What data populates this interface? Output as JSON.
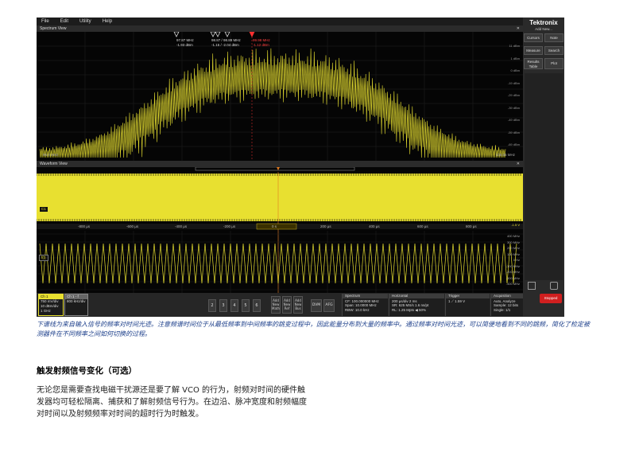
{
  "scope": {
    "menu": [
      "File",
      "Edit",
      "Utility",
      "Help"
    ],
    "brand": "Tektronix",
    "add_new": "Add New...",
    "buttons": [
      "Cursors",
      "Note",
      "Measure",
      "Search",
      "Results Table",
      "Plot"
    ],
    "stopped": "Stopped",
    "spectrum_view": {
      "title": "Spectrum View",
      "left_freq": "95.0 MHz",
      "right_freq": "105.06 MHz",
      "db_labels": [
        "11 dBm",
        "1 dBm",
        "0 dBm",
        "-19 dBm",
        "-29 dBm",
        "-39 dBm",
        "-49 dBm",
        "-59 dBm",
        "-69 dBm"
      ],
      "markers": [
        {
          "freq": "97.87 MHz",
          "level": "-1.93 dBm"
        },
        {
          "freq": "98.87 / 98.89 MHz",
          "level": "-1.15 / -2.04 dBm"
        },
        {
          "freq": "99.98 MHz",
          "level": "-1.12 dBm"
        }
      ]
    },
    "waveform_view": {
      "title": "Waveform View",
      "time_labels": [
        "-800 µs",
        "-600 µs",
        "-400 µs",
        "-200 µs",
        "0 s",
        "200 µs",
        "400 µs",
        "600 µs",
        "800 µs"
      ],
      "ch1_volts": [
        "3.75 V",
        "3 V",
        "2.25 V",
        "1.5 V",
        "750 mV",
        "0 V",
        "-750 mV",
        "-1.5 V"
      ],
      "freq_labels": [
        "400 MHz",
        "300 MHz",
        "200 MHz",
        "100 MHz",
        "0 Hz",
        "-100 MHz",
        "-200 MHz",
        "-300 MHz",
        "-400 MHz"
      ],
      "ch1_tag": "C1",
      "trace_tag": "f(t)"
    },
    "status": {
      "ch1_label": "Ch 1",
      "ch1_lines": [
        "750 mV/div",
        "10 dBm/div",
        "1 GHz"
      ],
      "ch1f_label": "Ch 1 - f",
      "ch1f_lines": [
        "800 kHz/div"
      ],
      "channels": [
        "2",
        "3",
        "4",
        "5",
        "6"
      ],
      "add_buttons": [
        "Add New Math",
        "Add New Ref",
        "Add New Bus"
      ],
      "dvm": "DVM",
      "afg": "AFG",
      "spectrum": {
        "title": "Spectrum",
        "lines": [
          "CF: 100.000000 MHz",
          "Span: 10.0000 MHz",
          "RBW: 10.0 kHz"
        ]
      },
      "horizontal": {
        "title": "Horizontal",
        "lines": [
          "200 µs/div     2 ms",
          "SR: 625 MS/s   1.6 ns/pt",
          "RL: 1.25 Mpts  ◀ 50%"
        ]
      },
      "trigger": {
        "title": "Trigger",
        "lines": [
          "1  ⟋  1.59 V"
        ]
      },
      "acquisition": {
        "title": "Acquisition",
        "lines": [
          "Auto,       Analyze",
          "Sample: 12 bits",
          "Single: 1/1"
        ]
      }
    },
    "colors": {
      "trace": "#e8e030",
      "background": "#050505",
      "stopped": "#d01f1f"
    }
  },
  "caption": "下谱线为来自输入信号的频率对时间光迹。注意频谱时间位于从最低频率到中间频率的跳变过程中，因此能量分布到大量的频率中。通过频率对时间光迹，可以简便地看到不同的跳频，简化了检定被测器件在不同频率之间如何切换的过程。",
  "heading": "触发射频信号变化（可选）",
  "paragraph": "无论您是需要查找电磁干扰源还是要了解 VCO 的行为，射频对时间的硬件触发器均可轻松隔离、捕获和了解射频信号行为。在边沿、脉冲宽度和射频幅度对时间以及射频频率对时间的超时行为时触发。"
}
